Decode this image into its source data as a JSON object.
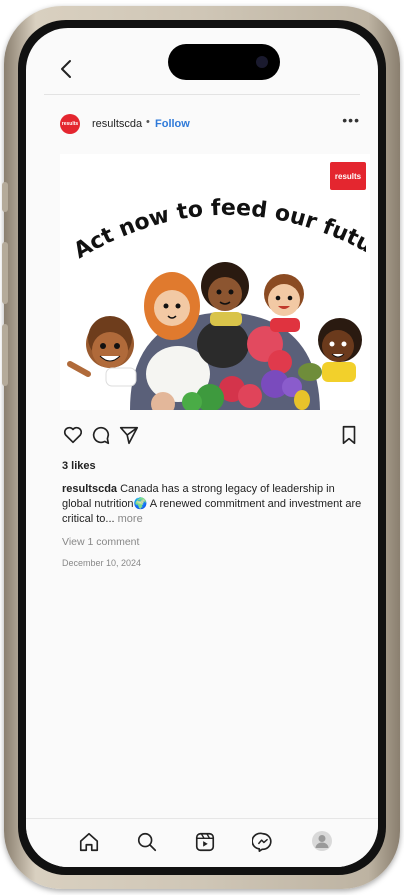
{
  "post": {
    "avatar_label": "results",
    "username": "resultscda",
    "separator": "•",
    "follow_label": "Follow",
    "more_icon": "•••"
  },
  "image": {
    "logo_text": "results",
    "headline": "Act now to feed our future!"
  },
  "actions": {
    "icons": [
      "heart-icon",
      "comment-icon",
      "share-icon",
      "bookmark-icon"
    ]
  },
  "likes": "3 likes",
  "caption": {
    "user": "resultscda",
    "text": "Canada has a strong legacy of leadership in global nutrition🌍 A renewed commitment and investment are critical to...",
    "more": "more"
  },
  "view_comments": "View 1 comment",
  "date": "December 10, 2024",
  "bottom_nav": {
    "icons": [
      "home-icon",
      "search-icon",
      "reels-icon",
      "messenger-icon",
      "profile-avatar"
    ]
  },
  "colors": {
    "brand_red": "#e4262f",
    "follow_blue": "#2f7ad9",
    "phone_gold": "#cfc6b6"
  }
}
